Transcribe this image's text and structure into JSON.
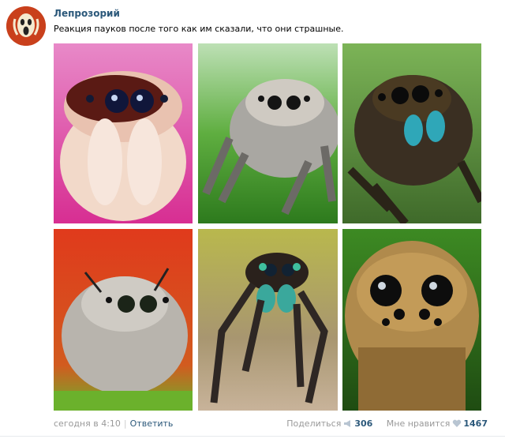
{
  "post": {
    "author": "Лепрозорий",
    "text": "Реакция пауков после того как им сказали, что они страшные.",
    "photos": [
      {
        "icon": "spider-photo-1"
      },
      {
        "icon": "spider-photo-2"
      },
      {
        "icon": "spider-photo-3"
      },
      {
        "icon": "spider-photo-4"
      },
      {
        "icon": "spider-photo-5"
      },
      {
        "icon": "spider-photo-6"
      }
    ],
    "footer": {
      "time": "сегодня в 4:10",
      "separator": "|",
      "reply": "Ответить",
      "share_label": "Поделиться",
      "share_count": "306",
      "like_label": "Мне нравится",
      "like_count": "1467"
    }
  },
  "colors": {
    "link": "#2b587a",
    "muted": "#999999",
    "avatar_bg": "#c9401c"
  }
}
